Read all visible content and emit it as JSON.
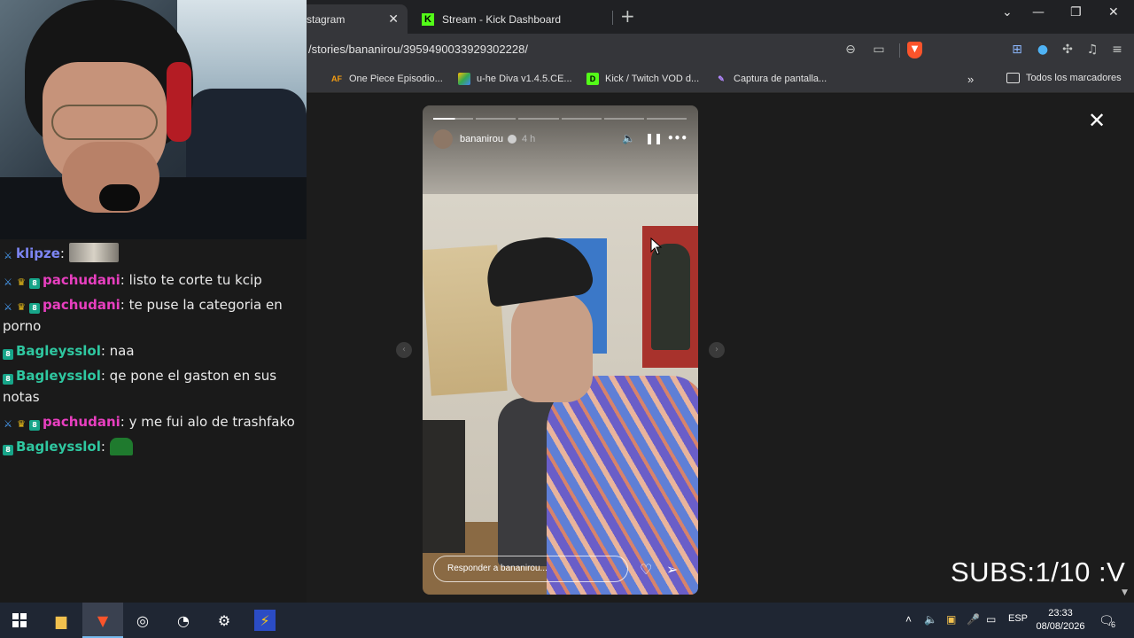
{
  "browser": {
    "tabs": [
      {
        "label": "stagram",
        "active": true
      },
      {
        "label": "Stream - Kick Dashboard",
        "active": false
      }
    ],
    "url": "/stories/bananirou/3959490033929302228/",
    "bookmarks": [
      {
        "label": "One Piece Episodio...",
        "icon": "AF"
      },
      {
        "label": "u-he Diva v1.4.5.CE...",
        "icon": "drive"
      },
      {
        "label": "Kick / Twitch VOD d...",
        "icon": "D"
      },
      {
        "label": "Captura de pantalla...",
        "icon": "pen"
      }
    ],
    "all_bookmarks": "Todos los marcadores"
  },
  "story": {
    "username": "bananirou",
    "time": "4 h",
    "reply_placeholder": "Responder a bananirou...",
    "progress_segments": 6,
    "current_segment": 1,
    "current_segment_fill": 0.55
  },
  "chat": {
    "messages": [
      {
        "user": "klipze",
        "color": "#7d86f5",
        "badges": [
          "sword"
        ],
        "text": "",
        "emote": "cat"
      },
      {
        "user": "pachudani",
        "color": "#e83fbf",
        "badges": [
          "sword",
          "crown",
          "sub"
        ],
        "text": "listo te corte tu kcip"
      },
      {
        "user": "pachudani",
        "color": "#e83fbf",
        "badges": [
          "sword",
          "crown",
          "sub"
        ],
        "text": "te puse la categoria en porno"
      },
      {
        "user": "Bagleysslol",
        "color": "#2fc7a0",
        "badges": [
          "sub"
        ],
        "text": "naa"
      },
      {
        "user": "Bagleysslol",
        "color": "#2fc7a0",
        "badges": [
          "sub"
        ],
        "text": "qe pone el gaston en sus notas"
      },
      {
        "user": "pachudani",
        "color": "#e83fbf",
        "badges": [
          "sword",
          "crown",
          "sub"
        ],
        "text": "y me fui alo de trashfako"
      },
      {
        "user": "Bagleysslol",
        "color": "#2fc7a0",
        "badges": [
          "sub"
        ],
        "text": "",
        "emote": "green"
      }
    ]
  },
  "overlay": {
    "subs": "SUBS:1/10 :V"
  },
  "taskbar": {
    "language": "ESP",
    "time": "23:33",
    "date": "08/08/2026",
    "notifications": "6"
  }
}
